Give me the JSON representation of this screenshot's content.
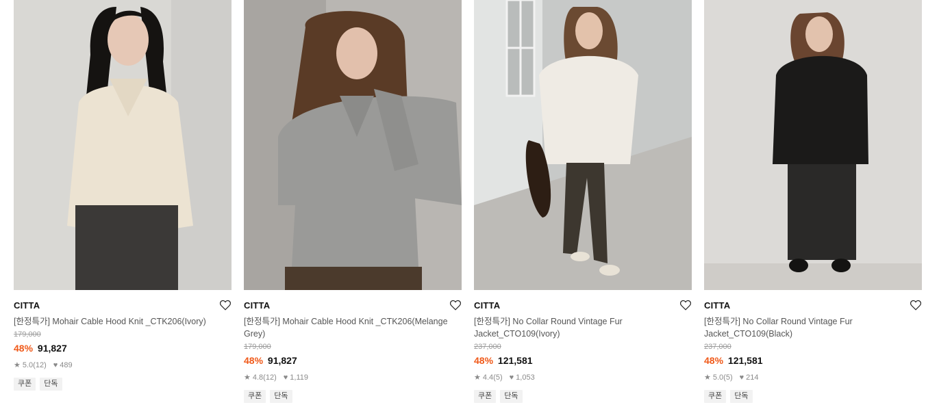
{
  "products": [
    {
      "brand": "CITTA",
      "title": "[한정특가] Mohair Cable Hood Knit _CTK206(Ivory)",
      "original_price": "179,000",
      "discount": "48%",
      "price": "91,827",
      "rating": "5.0",
      "reviews": "(12)",
      "likes": "489",
      "tags": [
        "쿠폰",
        "단독"
      ],
      "image_icon": "model-ivory-cable-hood-knit",
      "wish_icon": "heart-outline-icon"
    },
    {
      "brand": "CITTA",
      "title": "[한정특가] Mohair Cable Hood Knit _CTK206(Melange Grey)",
      "original_price": "179,000",
      "discount": "48%",
      "price": "91,827",
      "rating": "4.8",
      "reviews": "(12)",
      "likes": "1,119",
      "tags": [
        "쿠폰",
        "단독"
      ],
      "image_icon": "model-grey-cable-hood-knit",
      "wish_icon": "heart-outline-icon"
    },
    {
      "brand": "CITTA",
      "title": "[한정특가] No Collar Round Vintage Fur Jacket_CTO109(Ivory)",
      "original_price": "237,000",
      "discount": "48%",
      "price": "121,581",
      "rating": "4.4",
      "reviews": "(5)",
      "likes": "1,053",
      "tags": [
        "쿠폰",
        "단독"
      ],
      "image_icon": "model-ivory-fur-jacket",
      "wish_icon": "heart-outline-icon"
    },
    {
      "brand": "CITTA",
      "title": "[한정특가] No Collar Round Vintage Fur Jacket_CTO109(Black)",
      "original_price": "237,000",
      "discount": "48%",
      "price": "121,581",
      "rating": "5.0",
      "reviews": "(5)",
      "likes": "214",
      "tags": [
        "쿠폰",
        "단독"
      ],
      "image_icon": "model-black-fur-jacket",
      "wish_icon": "heart-outline-icon"
    }
  ],
  "colors": {
    "discount": "#f05a1a",
    "muted": "#8a8a8a",
    "tag_bg": "#f2f2f2"
  }
}
